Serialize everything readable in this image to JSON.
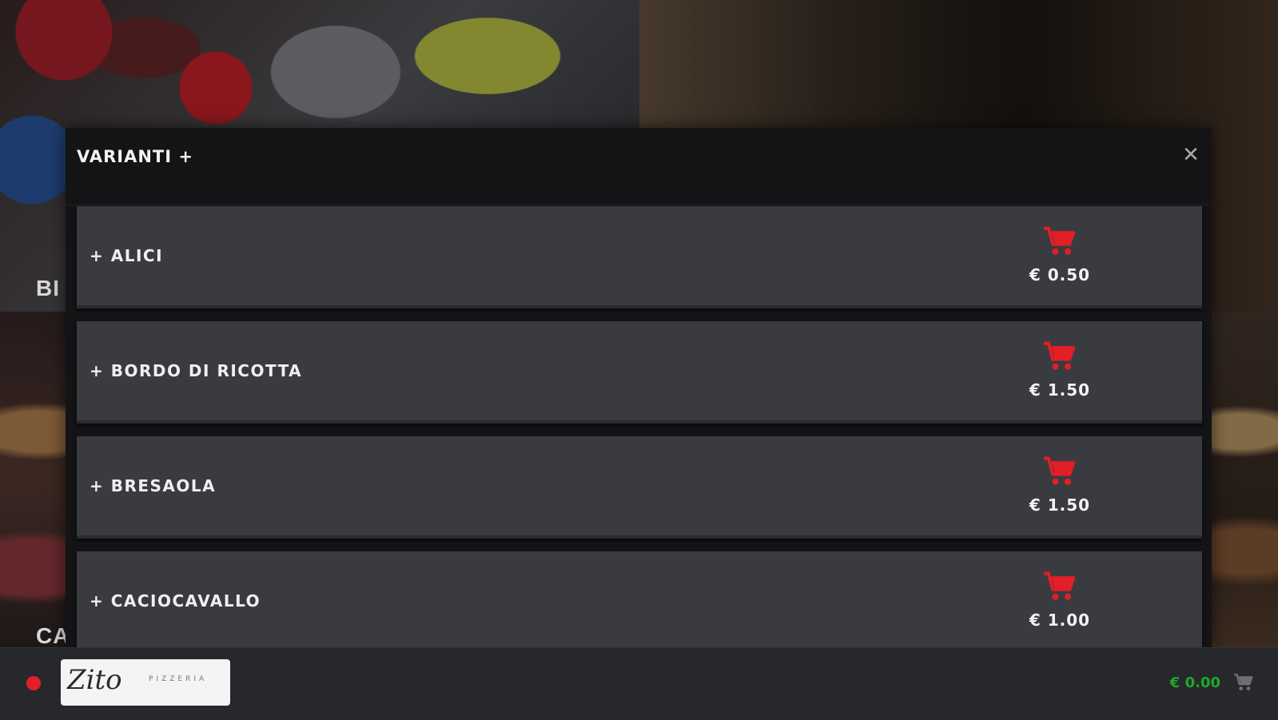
{
  "background": {
    "label_top": "BI",
    "label_bottom": "CA"
  },
  "modal": {
    "title": "VARIANTI +",
    "close_icon": "close-icon",
    "items": [
      {
        "name": "+ ALICI",
        "price": "€ 0.50",
        "icon": "cart-icon"
      },
      {
        "name": "+ BORDO DI RICOTTA",
        "price": "€ 1.50",
        "icon": "cart-icon"
      },
      {
        "name": "+ BRESAOLA",
        "price": "€ 1.50",
        "icon": "cart-icon"
      },
      {
        "name": "+ CACIOCAVALLO",
        "price": "€ 1.00",
        "icon": "cart-icon"
      }
    ]
  },
  "footer": {
    "logo_script": "Zito",
    "logo_text": "PIZZERIA",
    "cart_total": "€ 0.00",
    "cart_icon": "cart-icon"
  },
  "colors": {
    "accent_red": "#e21f26",
    "total_green": "#1fa82a",
    "row_bg": "#3a3b40",
    "modal_bg": "#141416"
  }
}
